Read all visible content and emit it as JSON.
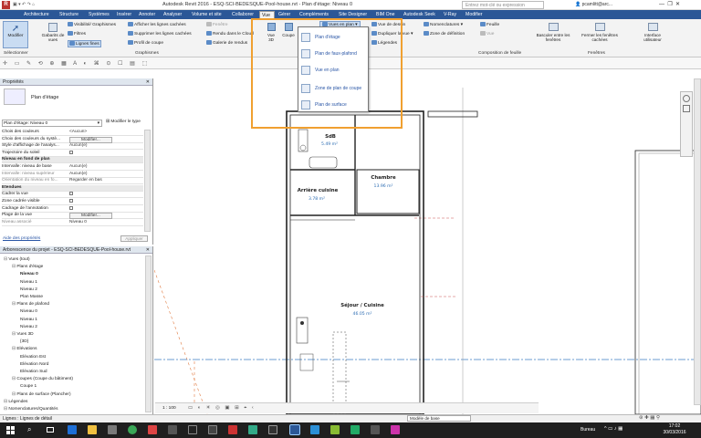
{
  "window": {
    "title": "Autodesk Revit 2016 -   ESQ-SCI-BEDESQUE-Pool-house.rvt - Plan d'étage: Niveau 0"
  },
  "search": {
    "placeholder": "Entrez mot-clé ou expression"
  },
  "user": {
    "name": "pcamlitt@arc..."
  },
  "tabs": [
    "Architecture",
    "Structure",
    "Systèmes",
    "Insérer",
    "Annoter",
    "Analyser",
    "Volume et site",
    "Collaborer",
    "Vue",
    "Gérer",
    "Compléments",
    "Site Designer",
    "BIM One",
    "Autodesk Seek",
    "V-Ray",
    "Modifier"
  ],
  "active_tab": "Vue",
  "ribbon": {
    "modify": "Modifier",
    "gabarits": "Gabarits de vues",
    "visibilite": "Visibilité/ Graphismes",
    "filtres": "Filtres",
    "lignes_fines": "Lignes fines",
    "afficher_lignes_cachees": "Afficher les lignes cachées",
    "supprimer_lignes_cachees": "Supprimer les lignes cachées",
    "profil_coupe": "Profil de coupe",
    "fenetre": "Fenêtre",
    "rendu": "Rendu dans le Cloud",
    "galerie": "Galerie de rendus",
    "vue3d": "Vue 3D",
    "coupe": "Coupe",
    "vues_en_plan": "Vues en plan",
    "vue_dessin": "Vue de dessin",
    "dupliquer": "Dupliquer la vue",
    "legendes": "Légendes",
    "nomenclatures": "Nomenclatures",
    "zone_definition": "Zone de définition",
    "feuille": "Feuille",
    "vue": "Vue",
    "basculer": "Basculer entre les fenêtres",
    "fermer": "Fermer les fenêtres cachées",
    "interface": "Interface utilisateur",
    "panel_selection": "Sélectionner",
    "panel_graphismes": "Graphismes",
    "panel_composition": "Composition de feuille",
    "panel_fenetres": "Fenêtres"
  },
  "dropdown": [
    "Plan d'étage",
    "Plan de faux-plafond",
    "Vue en plan",
    "Zone de plan de coupe",
    "Plan de surface"
  ],
  "properties": {
    "title": "Propriétés",
    "type_name": "Plan d'étage",
    "selector": "Plan d'étage: Niveau 0",
    "edit_type": "Modifier le type",
    "rows": [
      {
        "k": "Chois des couleurs",
        "v": "<Aucun>"
      },
      {
        "k": "Choix des couleurs du systè...",
        "v": "Modifier..."
      },
      {
        "k": "Style d'affichage de l'analys...",
        "v": "Aucun(e)"
      },
      {
        "k": "Trajectoire du soleil",
        "v": ""
      },
      {
        "k": "Niveau en fond de plan",
        "v": ""
      },
      {
        "k": "Intervalle: niveau de base",
        "v": "Aucun(e)"
      },
      {
        "k": "Intervalle: niveau supérieur",
        "v": "Aucun(e)"
      },
      {
        "k": "Orientation du niveau en fo...",
        "v": "Regarder en bas"
      },
      {
        "k": "Etendues",
        "v": ""
      },
      {
        "k": "Cadrer la vue",
        "v": ""
      },
      {
        "k": "Zone cadrée visible",
        "v": ""
      },
      {
        "k": "Cadrage de l'annotation",
        "v": ""
      },
      {
        "k": "Plage de la vue",
        "v": "Modifier..."
      },
      {
        "k": "Niveau associé",
        "v": "Niveau 0"
      }
    ],
    "help": "Aide des propriétés",
    "apply": "Appliquer"
  },
  "browser": {
    "title": "Arborescence du projet - ESQ-SCI-BEDESQUE-Pool-house.rvt",
    "nodes": [
      "Vues (tout)",
      "Plans d'étage",
      "Niveau 0",
      "Niveau 1",
      "Niveau 2",
      "Plan Masse",
      "Plans de plafond",
      "Niveau 0",
      "Niveau 1",
      "Niveau 2",
      "Vues 3D",
      "{3D}",
      "Elévations",
      "Elévation Est",
      "Elévation Nord",
      "Elévation Sud",
      "Coupes (Coupe du bâtiment)",
      "Coupe 1",
      "Plans de surface (Plancher)",
      "Légendes",
      "Nomenclatures/Quantités"
    ]
  },
  "rooms": [
    {
      "name": "SdB",
      "area": "5.49 m²"
    },
    {
      "name": "Chambre",
      "area": "13.96 m²"
    },
    {
      "name": "Arrière cuisine",
      "area": "3.78 m²"
    },
    {
      "name": "Séjour / Cuisine",
      "area": "46.05 m²"
    }
  ],
  "view_control": {
    "scale": "1 : 100"
  },
  "status": {
    "text": "Lignes : Lignes de détail",
    "model": "Modèle de base"
  },
  "taskbar": {
    "bureau": "Bureau",
    "time": "17:02",
    "date": "30/03/2016"
  }
}
